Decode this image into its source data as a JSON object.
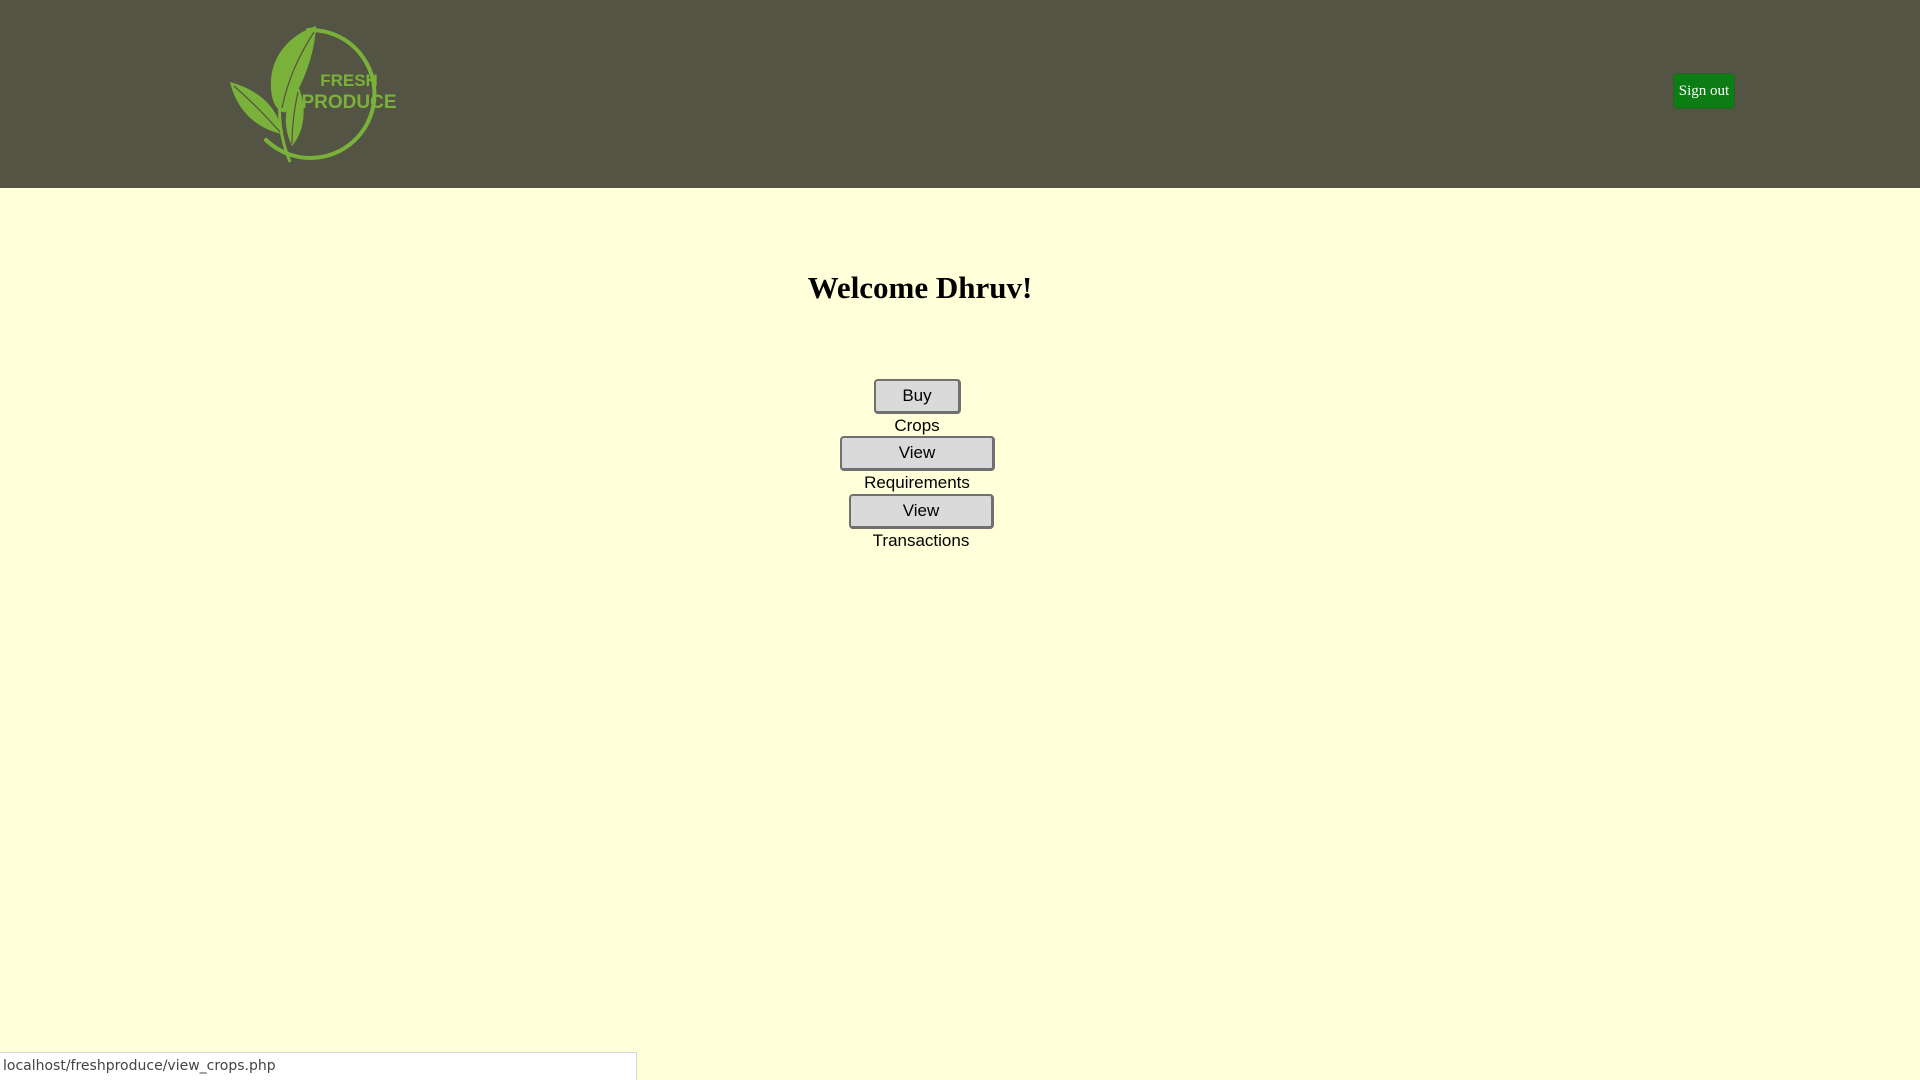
{
  "header": {
    "logo": {
      "line1": "FRESH",
      "line2": "PRODUCE",
      "alt": "Fresh Produce logo"
    },
    "signout_label": "Sign out"
  },
  "main": {
    "welcome_text": "Welcome Dhruv!",
    "buttons": {
      "buy_crops": "Buy Crops",
      "view_requirements": "View Requirements",
      "view_transactions": "View Transactions"
    }
  },
  "status_bar": {
    "url": "localhost/freshproduce/view_crops.php"
  },
  "colors": {
    "header_bg": "#535443",
    "page_bg": "#FFFFDA",
    "logo_green": "#7AB13A",
    "signout_bg": "#0B7D12",
    "button_bg": "#DADADA"
  },
  "icons": {
    "logo": "leaf-circle-icon"
  }
}
